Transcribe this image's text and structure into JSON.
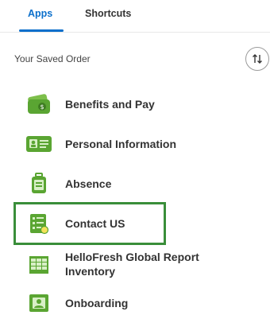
{
  "tabs": [
    {
      "label": "Apps"
    },
    {
      "label": "Shortcuts"
    }
  ],
  "saved_order_label": "Your Saved Order",
  "apps": [
    {
      "label": "Benefits and Pay",
      "icon": "wallet-icon"
    },
    {
      "label": "Personal Information",
      "icon": "id-card-icon"
    },
    {
      "label": "Absence",
      "icon": "suitcase-icon"
    },
    {
      "label": "Contact US",
      "icon": "contact-form-icon"
    },
    {
      "label": "HelloFresh Global Report Inventory",
      "icon": "spreadsheet-icon"
    },
    {
      "label": "Onboarding",
      "icon": "onboarding-icon"
    }
  ],
  "colors": {
    "accent": "#0b6fcb",
    "icon_green": "#5aa532",
    "highlight": "#3a8e3a"
  }
}
